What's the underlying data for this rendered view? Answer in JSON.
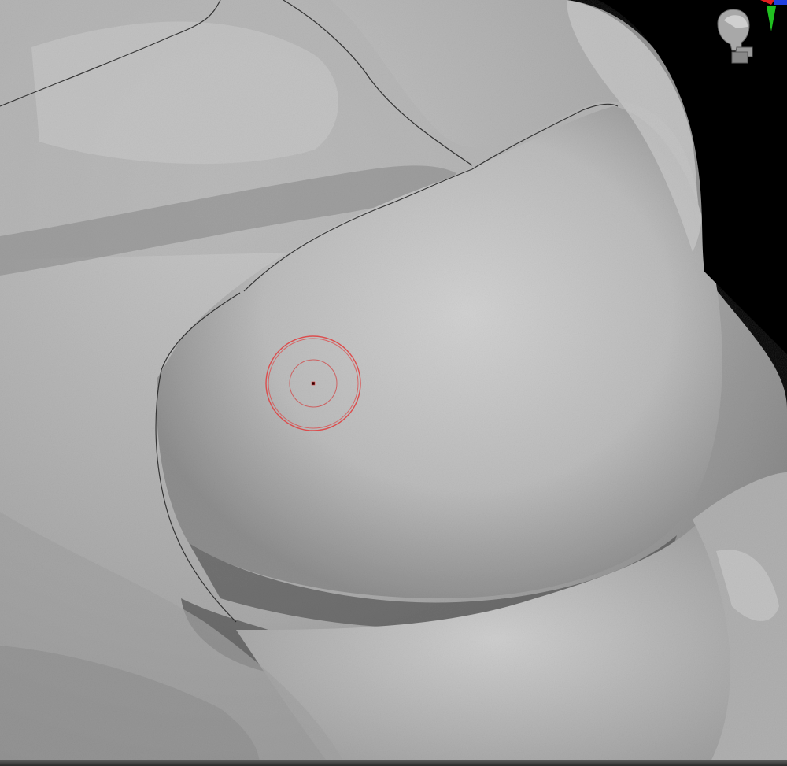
{
  "app": {
    "view": "3d-sculpt-viewport"
  },
  "viewport": {
    "background_color": "#000000",
    "mesh_color": "#bdbdbd",
    "shadow_color": "#4a4a4a",
    "highlight_color": "#e4e4e4"
  },
  "navigation_gizmo": {
    "icon": "head-navigation-icon",
    "axes": [
      {
        "name": "x-axis-arrow-icon",
        "color": "#e02020"
      },
      {
        "name": "y-axis-arrow-icon",
        "color": "#20c020"
      },
      {
        "name": "z-axis-arrow-icon",
        "color": "#2040e0"
      }
    ]
  },
  "brush_cursor": {
    "outer_color": "#e04040",
    "inner_color": "#d05050",
    "center_color": "#300000"
  }
}
